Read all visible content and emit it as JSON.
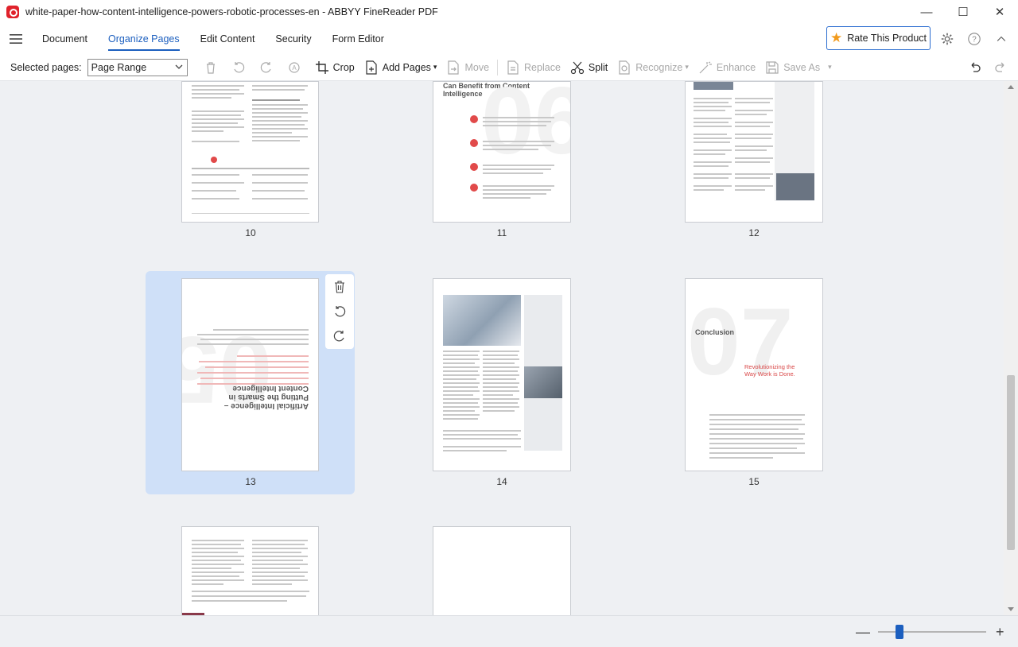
{
  "window": {
    "title": "white-paper-how-content-intelligence-powers-robotic-processes-en - ABBYY FineReader PDF",
    "minimize": "—",
    "maximize": "☐",
    "close": "✕"
  },
  "menu": {
    "items": [
      "Document",
      "Organize Pages",
      "Edit Content",
      "Security",
      "Form Editor"
    ],
    "active": "Organize Pages",
    "rate_label": "Rate This Product"
  },
  "toolbar": {
    "selected_pages_label": "Selected pages:",
    "selected_pages_value": "Page Range",
    "crop": "Crop",
    "add_pages": "Add Pages",
    "move": "Move",
    "replace": "Replace",
    "split": "Split",
    "recognize": "Recognize",
    "enhance": "Enhance",
    "save_as": "Save As"
  },
  "pages": {
    "p10": "10",
    "p11": "11",
    "p12": "12",
    "p13": "13",
    "p14": "14",
    "p15": "15",
    "p11_title": "Can Benefit from Content Intelligence",
    "p13_title": "Artificial Intelligence – Putting the Smarts in Content Intelligence",
    "p15_title": "Conclusion",
    "p15_subtitle": "Revolutionizing the Way Work is Done."
  },
  "status": {
    "zoom_minus": "—",
    "zoom_plus": "+",
    "zoom_level": 0.2
  }
}
